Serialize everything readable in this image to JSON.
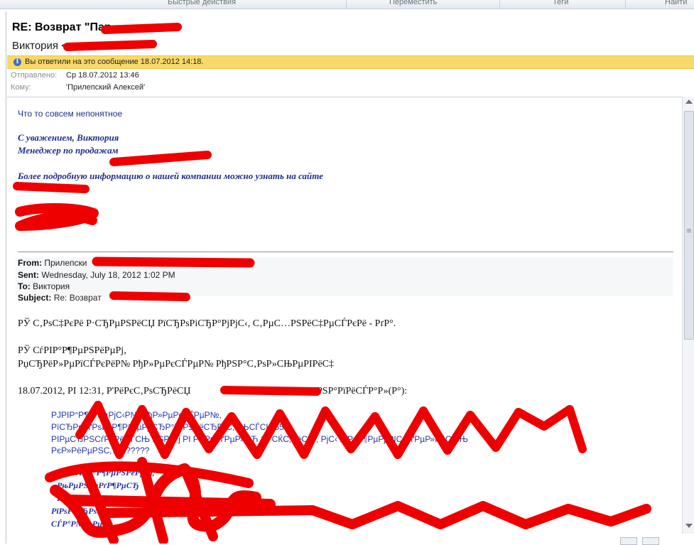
{
  "ribbon": {
    "quick_actions": "Быстрые действия",
    "move": "Переместить",
    "tags": "Теги",
    "find": "Найти"
  },
  "message": {
    "subject": "RE: Возврат  \"Пар",
    "sender": "Виктория <",
    "info_bar": "Вы ответили на это сообщение 18.07.2012 14:18.",
    "sent_label": "Отправлено:",
    "sent_value": "Ср 18.07.2012 13:46",
    "to_label": "Кому:",
    "to_value": "'Прилепский Алексей'"
  },
  "body": {
    "line1": "Что то совсем непонятное",
    "signature": [
      "С уважением, Виктория",
      "Менеджер по продажам",
      "",
      "Более подробную информацию о нашей компании можно узнать на сайте"
    ]
  },
  "forwarded": {
    "from_label": "From:",
    "from_value": "Прилепски",
    "sent_label": "Sent:",
    "sent_value": "Wednesday, July 18, 2012 1:02 PM",
    "to_label": "To:",
    "to_value": "Виктория",
    "subject_label": "Subject:",
    "subject_value": "Re: Возврат"
  },
  "garbled": {
    "l1": "РЎ С‚РѕС‡РєРё Р·СЂРµРЅРёСЏ РїСЂРѕРіСЂР°РјРјС‹, С‚РµС…РЅРёС‡РµСЃРєРё - РґР°.",
    "l2": "РЎ СѓРІР°Р¶РµРЅРёРµРј,",
    "l3": "РџСЂРёР»РµРїСЃРєРёР№ РђР»РµРєСЃРµР№ РђРЅР°С‚РѕР»СЊРµРІРёС‡",
    "l4": "18.07.2012, РІ 12:31, Р'РёРєС‚РѕСЂРёСЏ",
    "l4b": "РЅР°РїРёСЃР°Р»(Р°):",
    "q1": "РЈРІР°Р¶Р°РµРјС‹Р№ РђР»РµРєСЃРµР№,",
    "q2": "РїСЂРѕРґРѕР»Р¶Р°РµРј СЂР°Р·Р±РёСЂР°С‚СЊСЃСЏ 557",
    "q3": "РІРµСЂРЅСѓР»РёСЃСЊ РЅР°Рј РІ РЅРµРґРµР»СЋ 11 СЌС‚РёС…, РјС‹ РјРѕР¶РµРј РІС‹РґРµР»РёС‚СЊ",
    "q4": "РєР»РёРµРЅС‚????????",
    "qb1": "РЎ СѓРІР°Р¶РµРЅРёРµРј,",
    "qb2": "РњРµРЅРµРґР¶РµСЂ",
    "qb3": "Р‘РѕР»РµРµ",
    "qb4": "РїРѕРґСЂРѕР±РЅСѓСЋ РёРЅС„РѕСЂРјР°С†РёСЋ",
    "qb5": "СЃР°Р№С‚Рµ"
  },
  "colors": {
    "redaction": "#ee0000",
    "info_bar": "#f9d967",
    "text_blue": "#1f2e8a"
  }
}
